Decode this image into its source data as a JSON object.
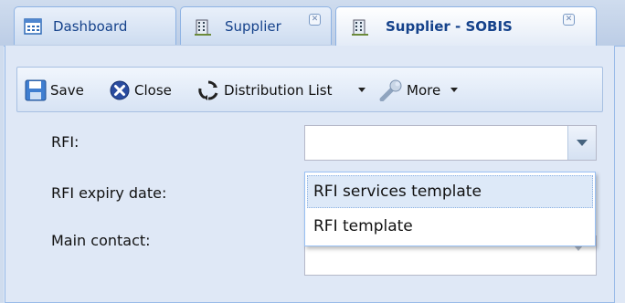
{
  "tabs": [
    {
      "label": "Dashboard",
      "icon": "dashboard-icon",
      "active": false,
      "closable": false
    },
    {
      "label": "Supplier",
      "icon": "building-icon",
      "active": false,
      "closable": true
    },
    {
      "label": "Supplier - SOBIS",
      "icon": "building-icon",
      "active": true,
      "closable": true
    }
  ],
  "toolbar": {
    "save": "Save",
    "close": "Close",
    "distribution_list": "Distribution List",
    "more": "More"
  },
  "form": {
    "rfi_label": "RFI:",
    "rfi_value": "",
    "rfi_expiry_label": "RFI expiry date:",
    "main_contact_label": "Main contact:"
  },
  "rfi_options": [
    "RFI services template",
    "RFI template"
  ],
  "colors": {
    "accent": "#15428b",
    "panel": "#dfe8f6",
    "close_icon": "#2a4c9f"
  }
}
